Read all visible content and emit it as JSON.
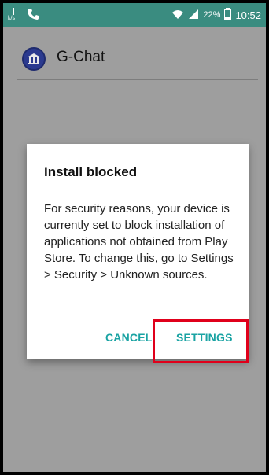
{
  "status_bar": {
    "time": "10:52",
    "battery_percent": "22%",
    "icons": [
      "signal-kbs-icon",
      "phone-icon",
      "wifi-icon",
      "cell-signal-icon",
      "battery-icon"
    ]
  },
  "app": {
    "title": "G-Chat",
    "icon": "bank-icon"
  },
  "dialog": {
    "title": "Install blocked",
    "body": "For security reasons, your device is currently set to block installation of applications not obtained from Play Store. To change this, go to Settings > Security > Unknown sources.",
    "cancel_label": "CANCEL",
    "settings_label": "SETTINGS"
  },
  "colors": {
    "statusbar": "#3a8c80",
    "background": "#9e9e9e",
    "button_accent": "#1aa3a3",
    "highlight": "#e0001b"
  }
}
